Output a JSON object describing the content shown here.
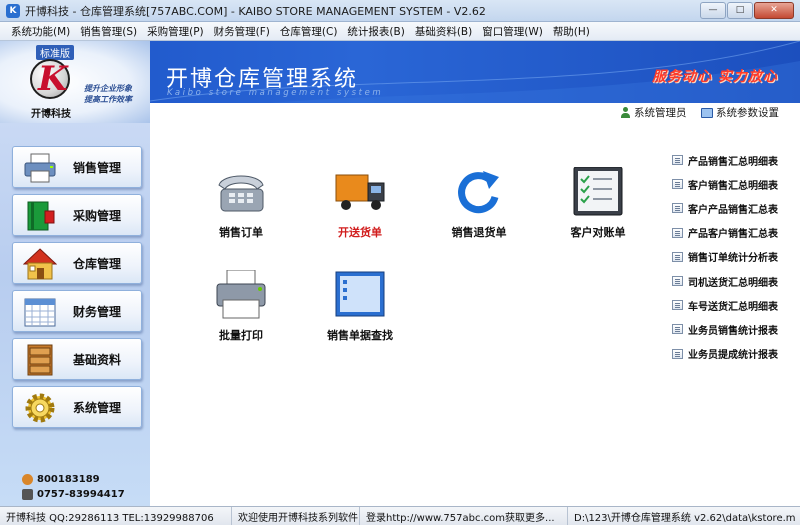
{
  "window": {
    "title": "开博科技 - 仓库管理系统[757ABC.COM] - KAIBO STORE MANAGEMENT SYSTEM - V2.62",
    "minimize": "—",
    "maximize": "□",
    "close": "✕"
  },
  "menu": [
    "系统功能(M)",
    "销售管理(S)",
    "采购管理(P)",
    "财务管理(F)",
    "仓库管理(C)",
    "统计报表(B)",
    "基础资料(B)",
    "窗口管理(W)",
    "帮助(H)"
  ],
  "banner": {
    "edition": "标准版",
    "logo_letter": "K",
    "company": "开博科技",
    "slogan_line1": "提升企业形象",
    "slogan_line2": "提高工作效率",
    "title": "开博仓库管理系统",
    "subtitle": "Kaibo store management system",
    "motto": "服务动心 实力放心"
  },
  "top_links": {
    "admin": "系统管理员",
    "settings": "系统参数设置"
  },
  "sidebar": [
    {
      "label": "销售管理",
      "icon": "printer-icon"
    },
    {
      "label": "采购管理",
      "icon": "book-icon"
    },
    {
      "label": "仓库管理",
      "icon": "house-icon"
    },
    {
      "label": "财务管理",
      "icon": "calendar-icon"
    },
    {
      "label": "基础资料",
      "icon": "cabinet-icon"
    },
    {
      "label": "系统管理",
      "icon": "gear-icon"
    }
  ],
  "contacts": {
    "qq": "800183189",
    "phone": "0757-83994417"
  },
  "functions": [
    {
      "label": "销售订单",
      "icon": "telephone-icon",
      "highlight": false
    },
    {
      "label": "开送货单",
      "icon": "truck-icon",
      "highlight": true
    },
    {
      "label": "销售退货单",
      "icon": "refresh-icon",
      "highlight": false
    },
    {
      "label": "客户对账单",
      "icon": "checklist-icon",
      "highlight": false
    },
    {
      "label": "批量打印",
      "icon": "printer-icon",
      "highlight": false
    },
    {
      "label": "销售单据查找",
      "icon": "window-icon",
      "highlight": false
    }
  ],
  "reports": [
    "产品销售汇总明细表",
    "客户销售汇总明细表",
    "客户产品销售汇总表",
    "产品客户销售汇总表",
    "销售订单统计分析表",
    "司机送货汇总明细表",
    "车号送货汇总明细表",
    "业务员销售统计报表",
    "业务员提成统计报表"
  ],
  "status": {
    "company": "开博科技 QQ:29286113 TEL:13929988706",
    "welcome": "欢迎使用开博科技系列软件",
    "login": "登录http://www.757abc.com获取更多...",
    "path": "D:\\123\\开博仓库管理系统 v2.62\\data\\kstore.m"
  },
  "colors": {
    "banner_blue": "#1c53c6",
    "motto_red": "#ff3b2a",
    "highlight_red": "#d11d1d"
  }
}
